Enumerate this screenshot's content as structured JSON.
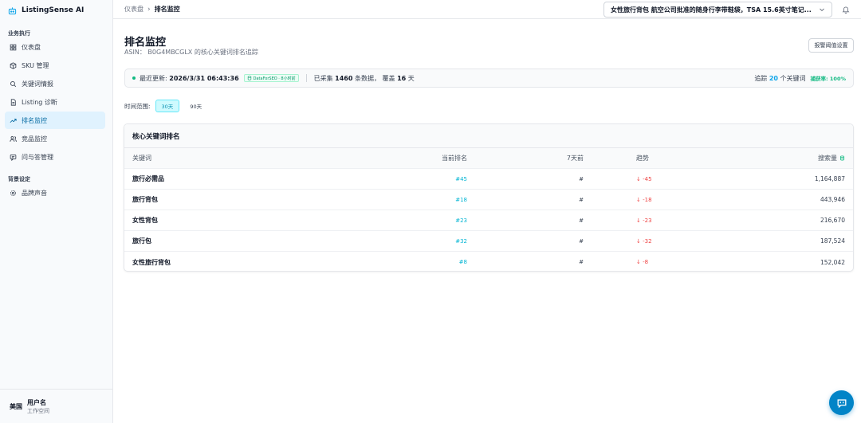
{
  "app": {
    "name": "ListingSense AI"
  },
  "sidebar": {
    "section1": "业务执行",
    "items1": [
      {
        "label": "仪表盘",
        "icon": "grid-icon"
      },
      {
        "label": "SKU 管理",
        "icon": "box-icon"
      },
      {
        "label": "关键词情报",
        "icon": "search-icon"
      },
      {
        "label": "Listing 诊断",
        "icon": "document-icon"
      },
      {
        "label": "排名监控",
        "icon": "trend-icon",
        "active": true
      },
      {
        "label": "竞品监控",
        "icon": "users-icon"
      },
      {
        "label": "问与答管理",
        "icon": "chat-icon"
      }
    ],
    "section2": "背景设定",
    "items2": [
      {
        "label": "品牌声音",
        "icon": "gear-icon"
      }
    ],
    "user": {
      "avatar": "美国",
      "name": "用户名",
      "workspace": "工作空间"
    }
  },
  "topbar": {
    "breadcrumb_root": "仪表盘",
    "breadcrumb_sep": "›",
    "breadcrumb_current": "排名监控",
    "product_selector": "女性旅行背包 航空公司批准的随身行李带鞋袋，TSA 15.6英寸笔记..."
  },
  "page": {
    "title": "排名监控",
    "subtitle": "ASIN： B0G4MBCGLX 的核心关键词排名追踪",
    "threshold_button": "报警阈值设置"
  },
  "status": {
    "updated_label": "最近更新:",
    "updated_value": "2026/3/31 06:43:36",
    "source_badge": "DataForSEO · 8小时前",
    "collected_prefix": "已采集",
    "collected_count": "1460",
    "collected_mid": "条数据，  覆盖",
    "days": "16",
    "days_suffix": "天",
    "tracking_prefix": "追踪",
    "tracking_count": "20",
    "tracking_suffix": "个关键词",
    "capture_rate": "捕获率: 100%"
  },
  "range": {
    "label": "时间范围:",
    "options": [
      "30天",
      "90天"
    ],
    "selected": "30天"
  },
  "table": {
    "title": "核心关键词排名",
    "headers": {
      "keyword": "关键词",
      "current": "当前排名",
      "seven_days": "7天前",
      "trend": "趋势",
      "volume": "搜索量"
    },
    "rows": [
      {
        "keyword": "旅行必需品",
        "current": "#45",
        "seven_days": "#",
        "trend": "↓ -45",
        "volume": "1,164,887"
      },
      {
        "keyword": "旅行背包",
        "current": "#18",
        "seven_days": "#",
        "trend": "↓ -18",
        "volume": "443,946"
      },
      {
        "keyword": "女性背包",
        "current": "#23",
        "seven_days": "#",
        "trend": "↓ -23",
        "volume": "216,670"
      },
      {
        "keyword": "旅行包",
        "current": "#32",
        "seven_days": "#",
        "trend": "↓ -32",
        "volume": "187,524"
      },
      {
        "keyword": "女性旅行背包",
        "current": "#8",
        "seven_days": "#",
        "trend": "↓ -8",
        "volume": "152,042"
      }
    ]
  },
  "colors": {
    "accent": "#0ea5e9",
    "active_bg": "#e0f2fe",
    "success": "#10b981",
    "danger": "#ef4444",
    "fab": "#0284c7"
  }
}
